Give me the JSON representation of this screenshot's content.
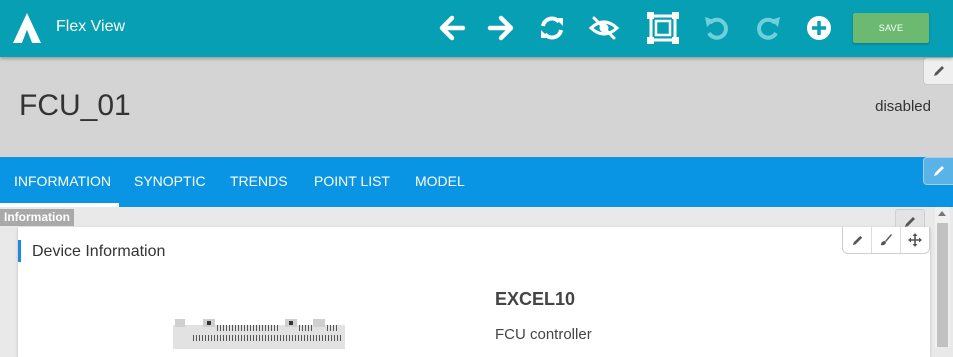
{
  "app": {
    "title": "Flex View"
  },
  "toolbar": {
    "save_label": "SAVE",
    "icons": [
      "arrow-left-icon",
      "arrow-right-icon",
      "refresh-icon",
      "eye-slash-icon",
      "select-frame-icon",
      "undo-icon",
      "redo-icon",
      "add-circle-icon"
    ],
    "colors": {
      "bar": "#069fb3",
      "save": "#6cba71",
      "disabled_icon": "#6fd0dc"
    }
  },
  "header": {
    "device_name": "FCU_01",
    "status": "disabled"
  },
  "tabs": [
    {
      "label": "INFORMATION",
      "active": true
    },
    {
      "label": "SYNOPTIC",
      "active": false
    },
    {
      "label": "TRENDS",
      "active": false
    },
    {
      "label": "POINT LIST",
      "active": false
    },
    {
      "label": "MODEL",
      "active": false
    }
  ],
  "content": {
    "section_label": "Information",
    "card": {
      "title": "Device Information",
      "model_name": "EXCEL10",
      "model_desc": "FCU controller",
      "tools": [
        "pencil-icon",
        "brush-icon",
        "move-icon"
      ]
    }
  }
}
